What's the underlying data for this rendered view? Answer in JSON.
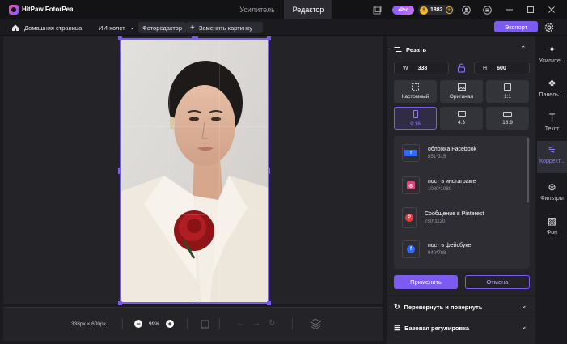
{
  "app": {
    "name": "HitPaw FotorPea"
  },
  "tabs": [
    {
      "label": "Усилитель"
    },
    {
      "label": "Редактор"
    }
  ],
  "titlebar": {
    "pro": "Pro",
    "coins": "1882"
  },
  "toolbar": {
    "home": "Домашняя страница",
    "ai_canvas": "ИИ-холст",
    "photo_editor": "Фоторедактор",
    "replace": "Заменить картинку",
    "export": "Экспорт"
  },
  "bottom": {
    "dims": "338px × 600px",
    "zoom": "99%"
  },
  "panel": {
    "crop_title": "Резать",
    "w_label": "W",
    "w_value": "338",
    "h_label": "H",
    "h_value": "600",
    "ratios": [
      {
        "label": "Кастомный"
      },
      {
        "label": "Оригинал"
      },
      {
        "label": "1:1"
      },
      {
        "label": "9:16"
      },
      {
        "label": "4:3"
      },
      {
        "label": "16:9"
      }
    ],
    "presets": [
      {
        "title": "обложка Facebook",
        "size": "851*315",
        "color": "#2f6bff",
        "glyph": "f"
      },
      {
        "title": "пост в инстаграме",
        "size": "1080*1080",
        "color": "#e0457b",
        "glyph": "◎"
      },
      {
        "title": "Сообщение в Pinterest",
        "size": "750*1120",
        "color": "#e23b3b",
        "glyph": "P"
      },
      {
        "title": "пост в фейсбуке",
        "size": "940*788",
        "color": "#2f6bff",
        "glyph": "f"
      }
    ],
    "apply": "Применить",
    "cancel": "Отмена",
    "flip_rotate": "Перевернуть и повернуть",
    "basic_adjust": "Базовая регулировка"
  },
  "rightbar": [
    {
      "label": "Усилите...",
      "icon": "enhance-icon"
    },
    {
      "label": "Панель ...",
      "icon": "panel-icon"
    },
    {
      "label": "Текст",
      "icon": "text-icon"
    },
    {
      "label": "Коррект...",
      "icon": "adjust-icon"
    },
    {
      "label": "Фильтры",
      "icon": "filter-icon"
    },
    {
      "label": "Фон",
      "icon": "background-icon"
    }
  ],
  "colors": {
    "accent": "#7c5cf0",
    "bg": "#1b1b1f",
    "panel": "#242428"
  }
}
